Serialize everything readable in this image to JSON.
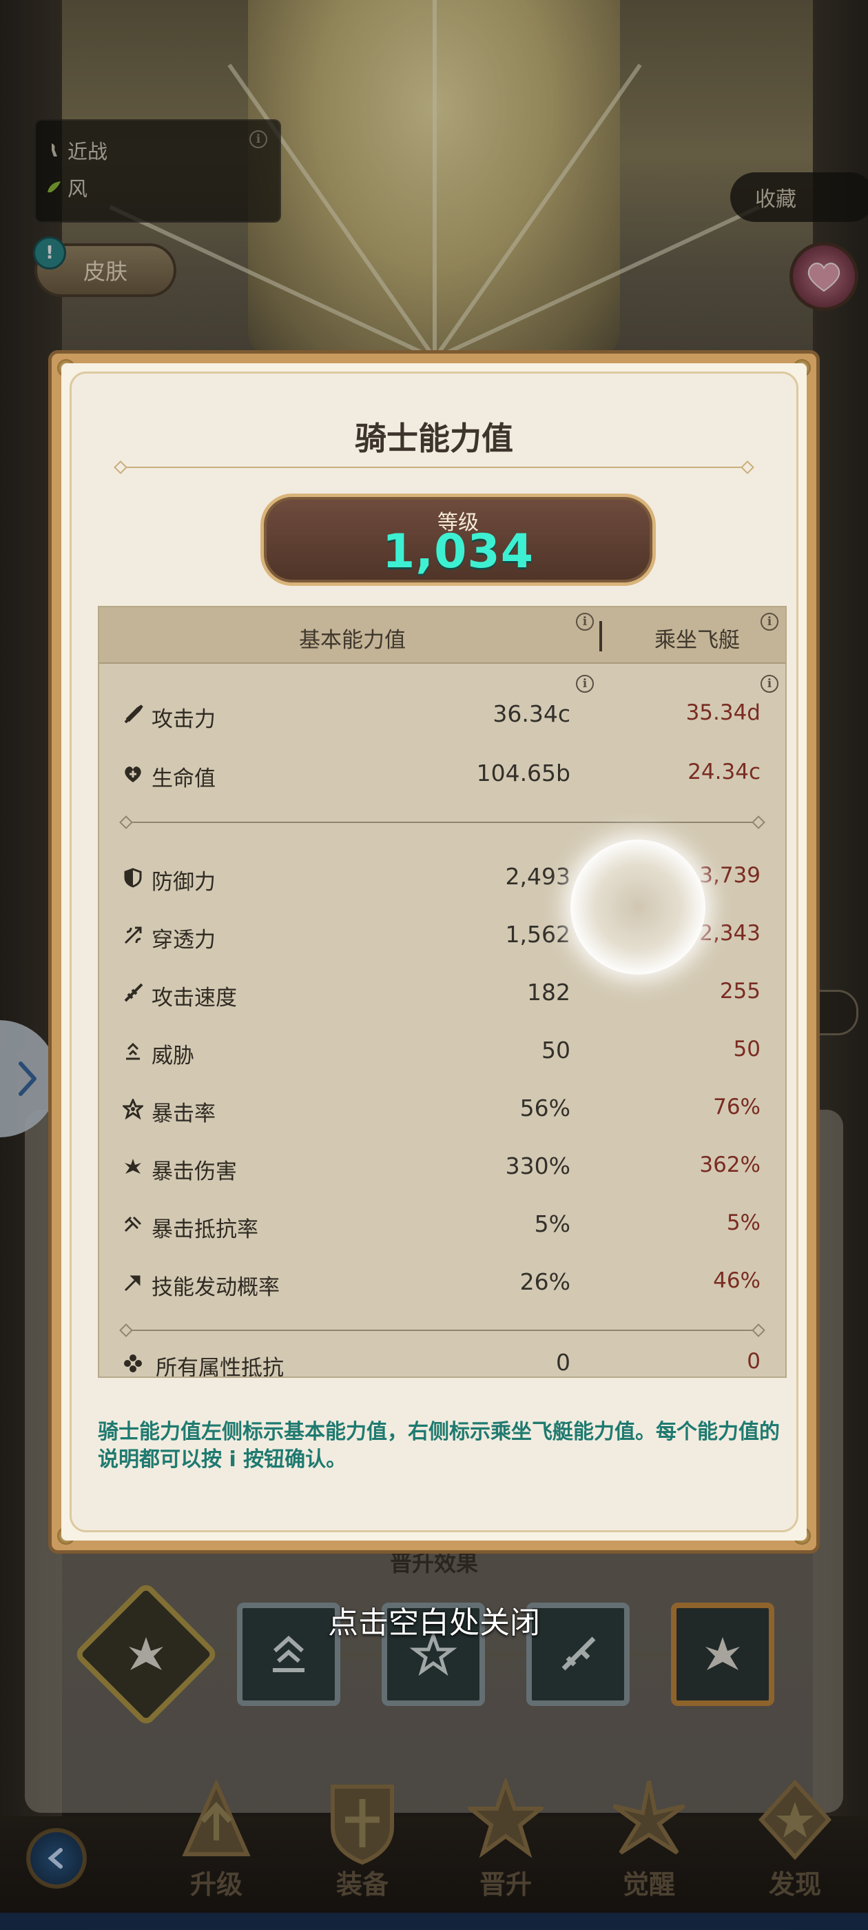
{
  "background": {
    "tags": [
      {
        "label": "近战",
        "icon": "melee-icon"
      },
      {
        "label": "风",
        "icon": "wind-icon"
      }
    ],
    "skin_button": "皮肤",
    "alert_badge": "!",
    "collect_button": "收藏",
    "promote_label": "晋升效果"
  },
  "modal": {
    "title": "骑士能力值",
    "level_label": "等级",
    "level_value": "1,034",
    "header_base": "基本能力值",
    "header_ride": "乘坐飞艇",
    "stats_group1": [
      {
        "name": "攻击力",
        "base": "36.34c",
        "ride": "35.34d",
        "icon": "sword-icon"
      },
      {
        "name": "生命值",
        "base": "104.65b",
        "ride": "24.34c",
        "icon": "heart-icon"
      }
    ],
    "stats_group2": [
      {
        "name": "防御力",
        "base": "2,493",
        "ride": "3,739",
        "icon": "shield-icon"
      },
      {
        "name": "穿透力",
        "base": "1,562",
        "ride": "2,343",
        "icon": "pierce-icon"
      },
      {
        "name": "攻击速度",
        "base": "182",
        "ride": "255",
        "icon": "attack-speed-icon"
      },
      {
        "name": "威胁",
        "base": "50",
        "ride": "50",
        "icon": "threat-icon"
      },
      {
        "name": "暴击率",
        "base": "56%",
        "ride": "76%",
        "icon": "crit-rate-icon"
      },
      {
        "name": "暴击伤害",
        "base": "330%",
        "ride": "362%",
        "icon": "crit-damage-icon"
      },
      {
        "name": "暴击抵抗率",
        "base": "5%",
        "ride": "5%",
        "icon": "crit-resist-icon"
      },
      {
        "name": "技能发动概率",
        "base": "26%",
        "ride": "46%",
        "icon": "skill-chance-icon"
      }
    ],
    "stats_group3": [
      {
        "name": "所有属性抵抗",
        "base": "0",
        "ride": "0",
        "icon": "all-resist-icon"
      }
    ],
    "description": "骑士能力值左侧标示基本能力值，右侧标示乘坐飞艇能力值。每个能力值的说明都可以按 i 按钮确认。"
  },
  "close_hint": "点击空白处关闭",
  "bottom_nav": [
    {
      "label": "升级",
      "icon": "upgrade-icon"
    },
    {
      "label": "装备",
      "icon": "equipment-icon"
    },
    {
      "label": "晋升",
      "icon": "promote-icon"
    },
    {
      "label": "觉醒",
      "icon": "awaken-icon"
    },
    {
      "label": "发现",
      "icon": "discover-icon"
    }
  ],
  "colors": {
    "level_value": "#3ef0d2",
    "ride_value": "#7a2c22",
    "description": "#1f7a70",
    "frame": "#c99b5f"
  }
}
